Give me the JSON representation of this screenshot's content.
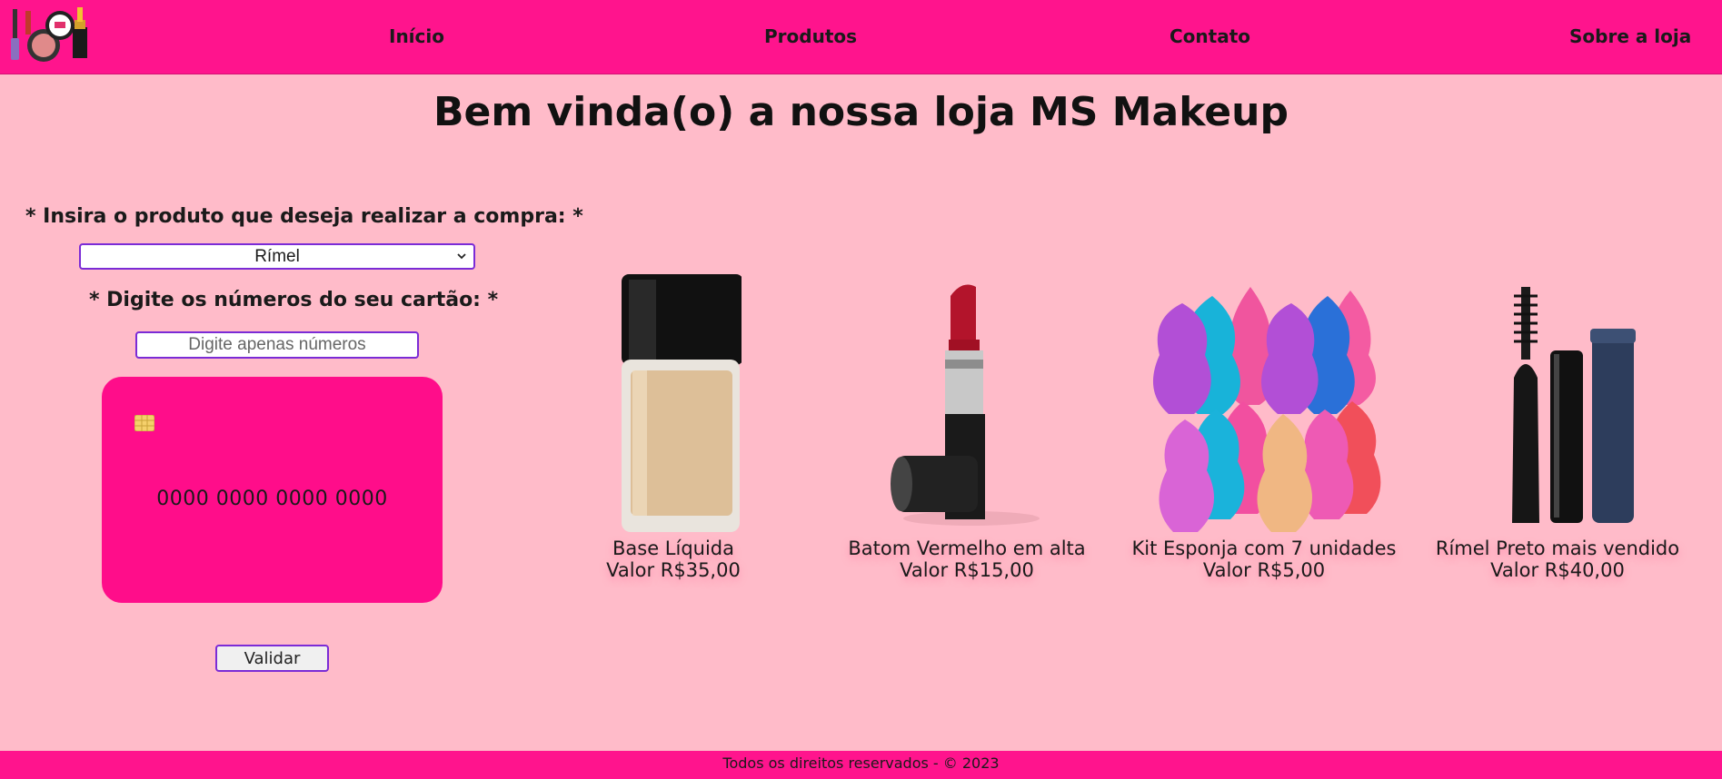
{
  "nav": {
    "items": [
      {
        "label": "Início"
      },
      {
        "label": "Produtos"
      },
      {
        "label": "Contato"
      },
      {
        "label": "Sobre a loja"
      }
    ]
  },
  "page_title": "Bem vinda(o) a nossa loja MS Makeup",
  "form": {
    "product_label": "* Insira o produto que deseja realizar a compra: *",
    "product_selected": "Rímel",
    "card_label": "* Digite os números do seu cartão: *",
    "card_placeholder": "Digite apenas números",
    "card_number_display": "0000 0000 0000 0000",
    "validate_label": "Validar"
  },
  "products": [
    {
      "name": "Base Líquida",
      "price": "Valor R$35,00",
      "icon": "foundation-bottle-icon"
    },
    {
      "name": "Batom Vermelho em alta",
      "price": "Valor R$15,00",
      "icon": "lipstick-icon"
    },
    {
      "name": "Kit Esponja com 7 unidades",
      "price": "Valor R$5,00",
      "icon": "makeup-sponges-icon"
    },
    {
      "name": "Rímel Preto mais vendido",
      "price": "Valor R$40,00",
      "icon": "mascara-icon"
    }
  ],
  "footer": {
    "text": "Todos os direitos reservados - © 2023"
  },
  "colors": {
    "brand_pink": "#ff148d",
    "background": "#ffbbc9",
    "card": "#ff0d8a",
    "input_border": "#7b2bd6"
  }
}
